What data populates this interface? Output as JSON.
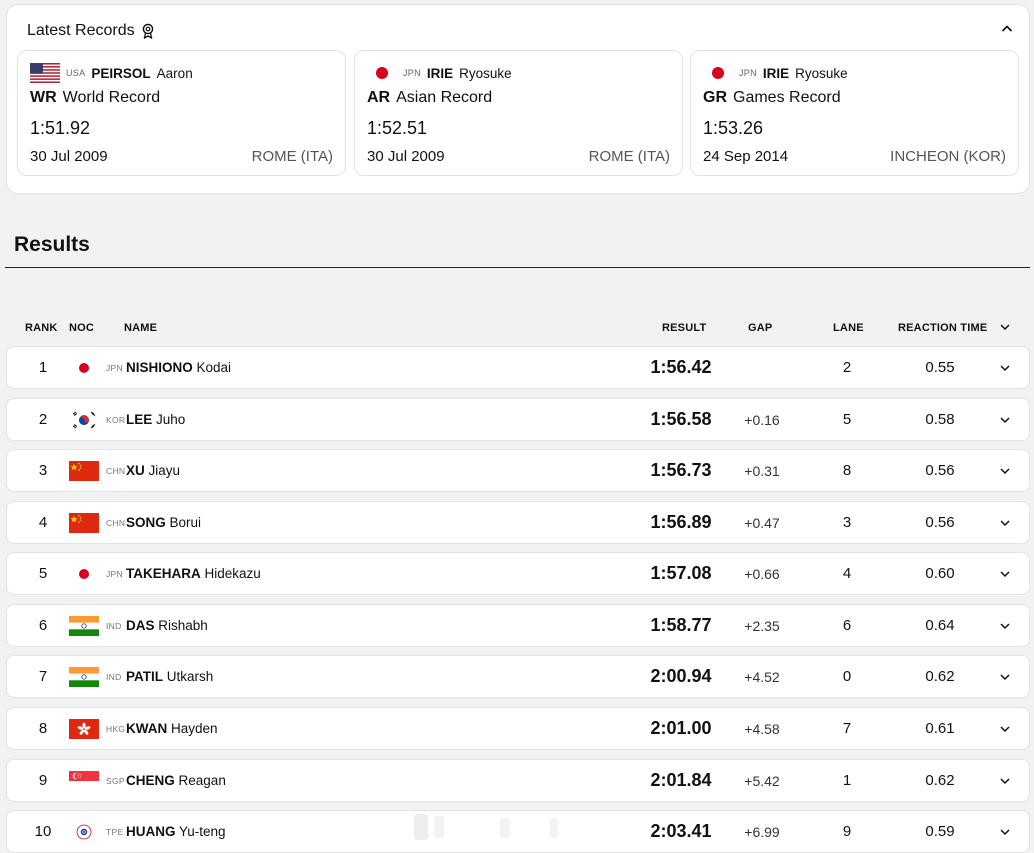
{
  "records": {
    "title": "Latest Records",
    "icon": "medal-icon",
    "cards": [
      {
        "noc": "USA",
        "last": "PEIRSOL",
        "first": "Aaron",
        "abbr": "WR",
        "type": "World Record",
        "time": "1:51.92",
        "date": "30 Jul 2009",
        "venue": "ROME (ITA)"
      },
      {
        "noc": "JPN",
        "last": "IRIE",
        "first": "Ryosuke",
        "abbr": "AR",
        "type": "Asian Record",
        "time": "1:52.51",
        "date": "30 Jul 2009",
        "venue": "ROME (ITA)"
      },
      {
        "noc": "JPN",
        "last": "IRIE",
        "first": "Ryosuke",
        "abbr": "GR",
        "type": "Games Record",
        "time": "1:53.26",
        "date": "24 Sep 2014",
        "venue": "INCHEON (KOR)"
      }
    ]
  },
  "results": {
    "heading": "Results",
    "columns": {
      "rank": "RANK",
      "noc": "NOC",
      "name": "NAME",
      "result": "RESULT",
      "gap": "GAP",
      "lane": "LANE",
      "reaction": "REACTION TIME"
    },
    "rows": [
      {
        "rank": "1",
        "noc": "JPN",
        "last": "NISHIONO",
        "first": "Kodai",
        "result": "1:56.42",
        "gap": "",
        "lane": "2",
        "rt": "0.55"
      },
      {
        "rank": "2",
        "noc": "KOR",
        "last": "LEE",
        "first": "Juho",
        "result": "1:56.58",
        "gap": "+0.16",
        "lane": "5",
        "rt": "0.58"
      },
      {
        "rank": "3",
        "noc": "CHN",
        "last": "XU",
        "first": "Jiayu",
        "result": "1:56.73",
        "gap": "+0.31",
        "lane": "8",
        "rt": "0.56"
      },
      {
        "rank": "4",
        "noc": "CHN",
        "last": "SONG",
        "first": "Borui",
        "result": "1:56.89",
        "gap": "+0.47",
        "lane": "3",
        "rt": "0.56"
      },
      {
        "rank": "5",
        "noc": "JPN",
        "last": "TAKEHARA",
        "first": "Hidekazu",
        "result": "1:57.08",
        "gap": "+0.66",
        "lane": "4",
        "rt": "0.60"
      },
      {
        "rank": "6",
        "noc": "IND",
        "last": "DAS",
        "first": "Rishabh",
        "result": "1:58.77",
        "gap": "+2.35",
        "lane": "6",
        "rt": "0.64"
      },
      {
        "rank": "7",
        "noc": "IND",
        "last": "PATIL",
        "first": "Utkarsh",
        "result": "2:00.94",
        "gap": "+4.52",
        "lane": "0",
        "rt": "0.62"
      },
      {
        "rank": "8",
        "noc": "HKG",
        "last": "KWAN",
        "first": "Hayden",
        "result": "2:01.00",
        "gap": "+4.58",
        "lane": "7",
        "rt": "0.61"
      },
      {
        "rank": "9",
        "noc": "SGP",
        "last": "CHENG",
        "first": "Reagan",
        "result": "2:01.84",
        "gap": "+5.42",
        "lane": "1",
        "rt": "0.62"
      },
      {
        "rank": "10",
        "noc": "TPE",
        "last": "HUANG",
        "first": "Yu-teng",
        "result": "2:03.41",
        "gap": "+6.99",
        "lane": "9",
        "rt": "0.59"
      }
    ]
  },
  "colors": {
    "accent": "#111111",
    "jpn_red": "#d7001e",
    "chn_red": "#de2910",
    "ind_saffron": "#ff9933",
    "ind_green": "#138808",
    "hkg_red": "#de2910"
  }
}
